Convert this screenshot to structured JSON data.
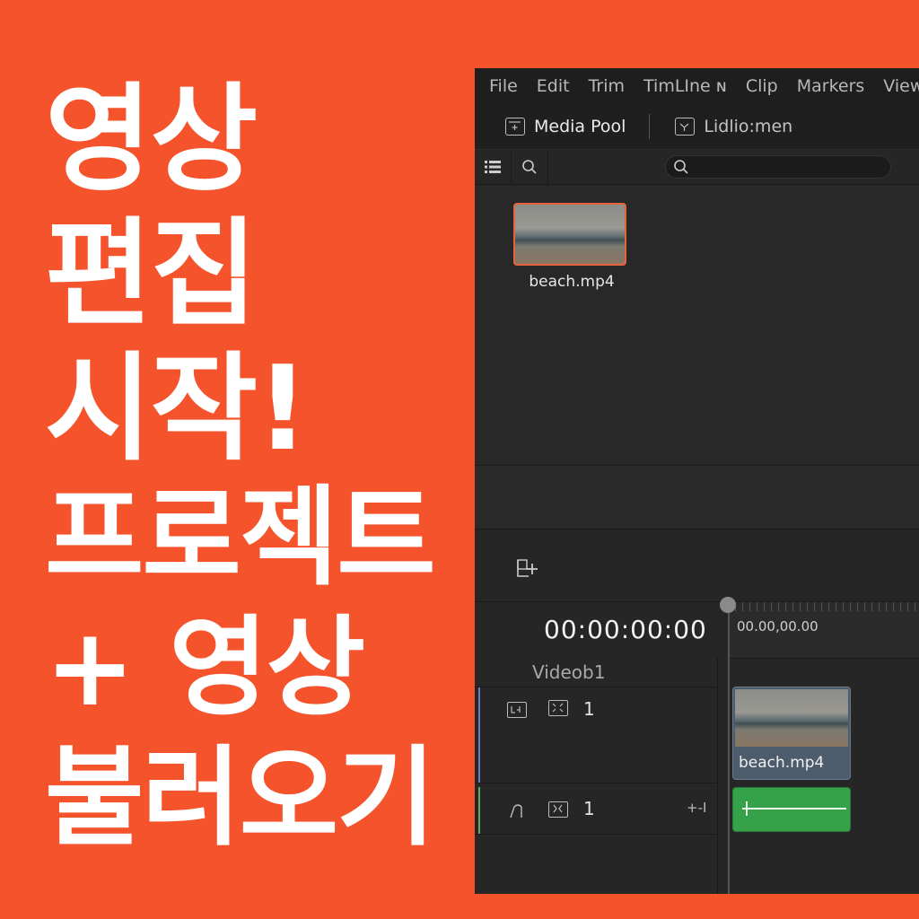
{
  "headline": {
    "line1": "영상",
    "line2": "편집",
    "line3": "시작!",
    "line4": "프로젝트",
    "line5": "+ 영상",
    "line6": "불러오기"
  },
  "app": {
    "menu": [
      "File",
      "Edit",
      "Trim",
      "TimLIne ɴ",
      "Clip",
      "Markers",
      "View"
    ],
    "tabs": {
      "media_pool": "Media Pool",
      "second": "Lidlio:men"
    },
    "search": {
      "placeholder": ""
    },
    "media_pool": {
      "clip_name": "beach.mp4"
    },
    "timeline": {
      "timecode": "00:00:00:00",
      "ruler_time": "00.00,00.00",
      "video_track_label": "Videob1",
      "video_track_number": "1",
      "audio_track_number": "1",
      "audio_track_control": "+-I",
      "video_clip_name": "beach.mp4"
    }
  },
  "colors": {
    "background": "#f4532b",
    "clip_selected_border": "#e8633c",
    "audio_clip": "#35a24a",
    "video_clip": "#4c5c6c"
  }
}
